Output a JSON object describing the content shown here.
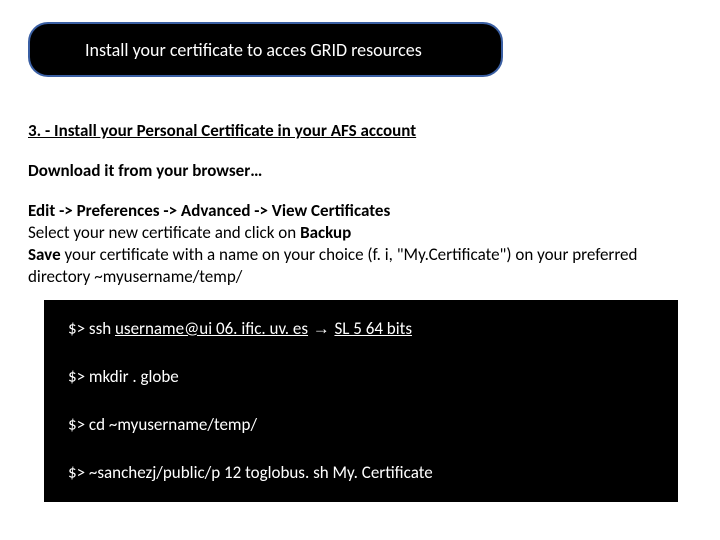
{
  "title": "Install your certificate to acces GRID resources",
  "section_heading": "3. - Install your Personal Certificate in your AFS account",
  "download_line": "Download it from your browser…",
  "instructions": {
    "nav_path": "Edit -> Preferences -> Advanced -> View Certificates",
    "select_pre": "Select your new certificate and click on ",
    "backup_word": "Backup",
    "save_word": "Save",
    "save_rest": " your certificate with a name on your choice (f. i, \"My.Certificate\") on your preferred directory ~myusername/temp/"
  },
  "terminal": {
    "line1_pre": "$> ssh ",
    "line1_host": "username@ui 06. ific. uv. es",
    "line1_arrow": "  → ",
    "line1_post": "SL 5 64 bits",
    "line2": "$> mkdir . globe",
    "line3": "$> cd  ~myusername/temp/",
    "line4": "$> ~sanchezj/public/p 12 toglobus. sh My. Certificate"
  }
}
